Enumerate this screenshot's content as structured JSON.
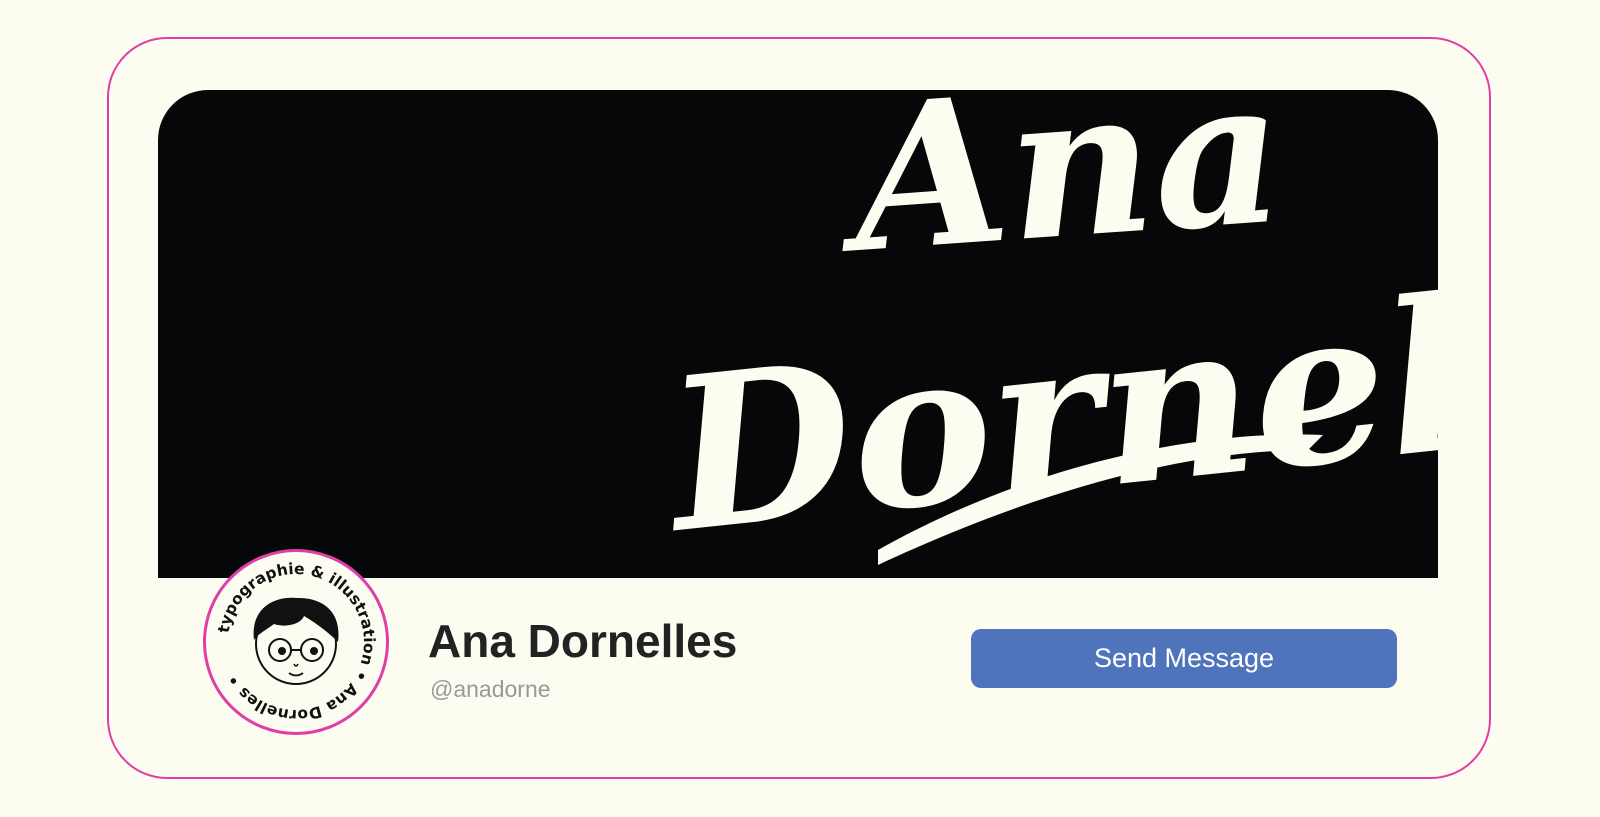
{
  "banner": {
    "logo_text_line1": "Ana",
    "logo_text_line2": "Dornelles",
    "background_color": "#060708",
    "lettering_color": "#fdfcf0"
  },
  "avatar": {
    "ring_text": "typographie & illustration • Ana Dornelles •",
    "border_color": "#e03ea6"
  },
  "profile": {
    "name": "Ana Dornelles",
    "handle": "@anadorne"
  },
  "actions": {
    "send_message_label": "Send Message",
    "button_color": "#4f74bb"
  },
  "card": {
    "border_color": "#e03ea6",
    "background_color": "#fdfcf0"
  }
}
